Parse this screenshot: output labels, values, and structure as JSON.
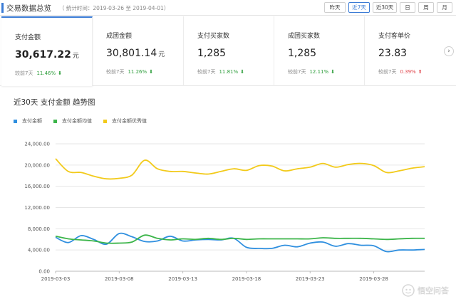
{
  "header": {
    "title": "交易数据总览",
    "period": "（ 统计时间：2019-03-26 至 2019-04-01）",
    "ranges": [
      "昨天",
      "近7天",
      "近30天",
      "日",
      "周",
      "月"
    ],
    "active_range": "近7天"
  },
  "metrics": [
    {
      "label": "支付金额",
      "value": "30,617.22",
      "unit": "元",
      "compare_label": "较前7天",
      "pct": "11.46%",
      "direction": "down"
    },
    {
      "label": "成团金额",
      "value": "30,801.14",
      "unit": "元",
      "compare_label": "较前7天",
      "pct": "11.26%",
      "direction": "down"
    },
    {
      "label": "支付买家数",
      "value": "1,285",
      "unit": "",
      "compare_label": "较前7天",
      "pct": "11.81%",
      "direction": "down"
    },
    {
      "label": "成团买家数",
      "value": "1,285",
      "unit": "",
      "compare_label": "较前7天",
      "pct": "12.11%",
      "direction": "down"
    },
    {
      "label": "支付客单价",
      "value": "23.83",
      "unit": "",
      "compare_label": "较前7天",
      "pct": "0.39%",
      "direction": "up"
    }
  ],
  "next_icon": "chevron-right-icon",
  "chart_section_title": "近30天 支付金额 趋势图",
  "chart_data": {
    "type": "line",
    "title": "近30天 支付金额 趋势图",
    "x": [
      "2019-03-03",
      "2019-03-04",
      "2019-03-05",
      "2019-03-06",
      "2019-03-07",
      "2019-03-08",
      "2019-03-09",
      "2019-03-10",
      "2019-03-11",
      "2019-03-12",
      "2019-03-13",
      "2019-03-14",
      "2019-03-15",
      "2019-03-16",
      "2019-03-17",
      "2019-03-18",
      "2019-03-19",
      "2019-03-20",
      "2019-03-21",
      "2019-03-22",
      "2019-03-23",
      "2019-03-24",
      "2019-03-25",
      "2019-03-26",
      "2019-03-27",
      "2019-03-28",
      "2019-03-29",
      "2019-03-30",
      "2019-03-31",
      "2019-04-01"
    ],
    "x_tick_labels": [
      "2019-03-03",
      "2019-03-08",
      "2019-03-13",
      "2019-03-18",
      "2019-03-23",
      "2019-03-28"
    ],
    "y_ticks": [
      "0.00",
      "4,000.00",
      "8,000.00",
      "12,000.00",
      "16,000.00",
      "20,000.00",
      "24,000.00"
    ],
    "ylim": [
      0,
      24000
    ],
    "series": [
      {
        "name": "支付金额",
        "color": "#2f8fdf",
        "values": [
          6400,
          5400,
          6700,
          6000,
          5100,
          7100,
          6500,
          5600,
          5700,
          6600,
          5700,
          5900,
          6000,
          5900,
          6200,
          4500,
          4300,
          4300,
          4900,
          4600,
          5300,
          5500,
          4700,
          5200,
          4900,
          4800,
          3700,
          4000,
          4000,
          4100
        ]
      },
      {
        "name": "支付金额均值",
        "color": "#3cb54a",
        "values": [
          6600,
          6100,
          5900,
          5700,
          5300,
          5300,
          5500,
          6800,
          6200,
          5900,
          6100,
          6000,
          6200,
          6000,
          6200,
          6000,
          6100,
          6100,
          6100,
          6100,
          6100,
          6300,
          6200,
          6200,
          6200,
          6100,
          6000,
          6100,
          6200,
          6200
        ]
      },
      {
        "name": "支付金额优秀值",
        "color": "#f2ca1a",
        "values": [
          21200,
          18800,
          18600,
          17900,
          17400,
          17500,
          18100,
          20900,
          19300,
          18800,
          18800,
          18500,
          18300,
          18800,
          19300,
          19000,
          19900,
          19800,
          18900,
          19300,
          19600,
          20300,
          19600,
          20100,
          20300,
          19900,
          18600,
          18900,
          19400,
          19700
        ]
      }
    ]
  },
  "watermark": "悟空问答"
}
